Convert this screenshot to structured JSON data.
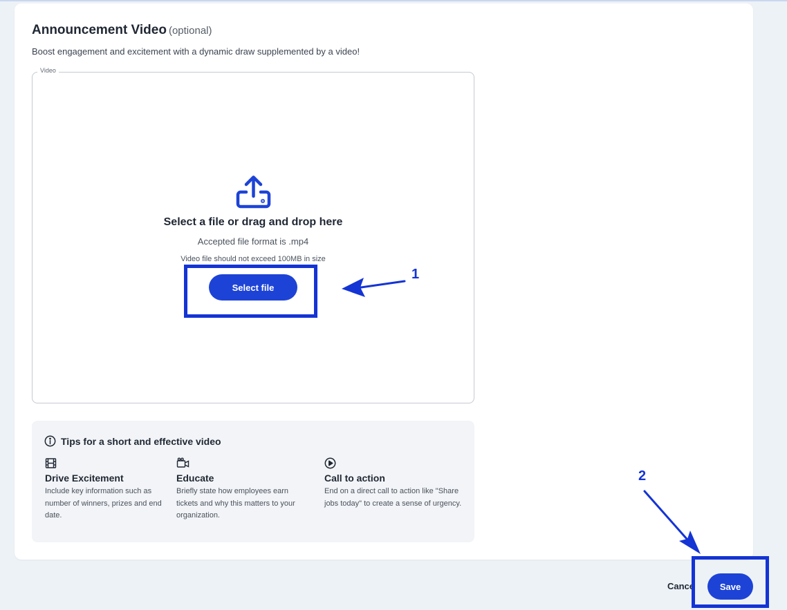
{
  "section": {
    "title": "Announcement Video",
    "optional_label": "(optional)",
    "description": "Boost engagement and excitement with a dynamic draw supplemented by a video!"
  },
  "upload": {
    "legend": "Video",
    "icon": "upload-icon",
    "title": "Select a file or drag and drop here",
    "format_text": "Accepted file format is .mp4",
    "size_text": "Video file should not exceed 100MB in size",
    "button_label": "Select file"
  },
  "tips": {
    "icon": "info-icon",
    "title": "Tips for a short and effective video",
    "items": [
      {
        "icon": "film-icon",
        "title": "Drive Excitement",
        "description": "Include key information such as number of winners, prizes and end date."
      },
      {
        "icon": "video-camera-icon",
        "title": "Educate",
        "description": "Briefly state how employees earn tickets and why this matters to your organization."
      },
      {
        "icon": "play-circle-icon",
        "title": "Call to action",
        "description": "End on a direct call to action like \"Share jobs today\" to create a sense of urgency."
      }
    ]
  },
  "footer": {
    "cancel_label": "Cancel",
    "save_label": "Save"
  },
  "annotations": {
    "step_1": "1",
    "step_2": "2",
    "color": "#1434d4"
  },
  "colors": {
    "primary": "#1d43d6",
    "background": "#edf2f7",
    "card": "#ffffff"
  }
}
